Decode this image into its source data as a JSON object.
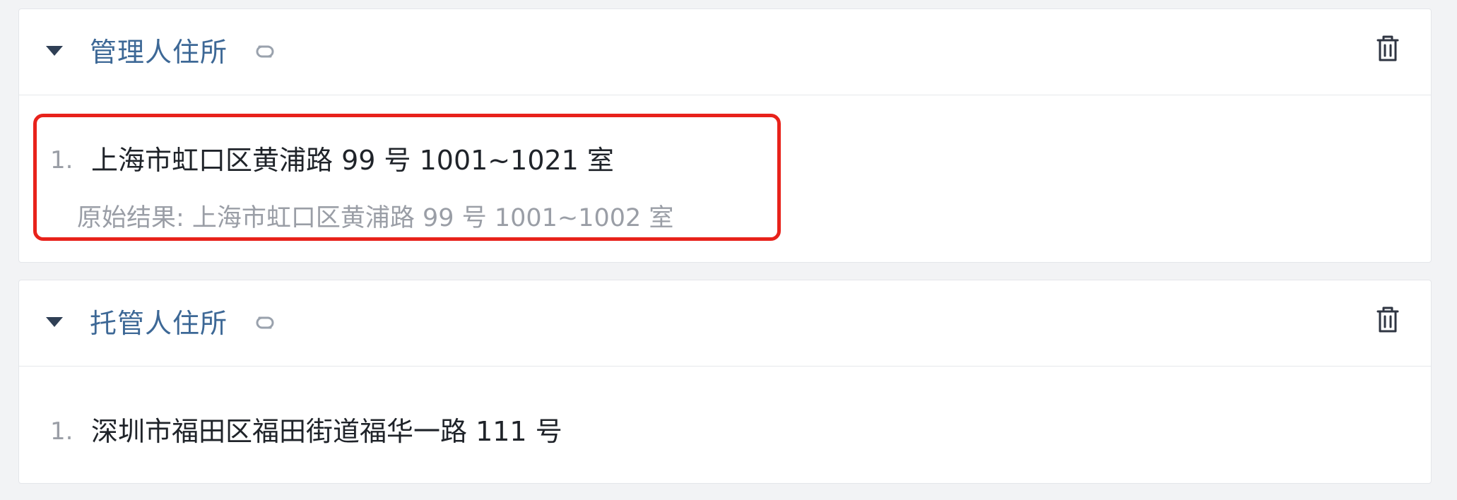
{
  "sections": [
    {
      "title": "管理人住所",
      "items": [
        {
          "index": "1.",
          "value": "上海市虹口区黄浦路 99 号 1001~1021 室",
          "original_label": "原始结果: 上海市虹口区黄浦路 99 号 1001~1002 室"
        }
      ]
    },
    {
      "title": "托管人住所",
      "items": [
        {
          "index": "1.",
          "value": "深圳市福田区福田街道福华一路 111 号"
        }
      ]
    }
  ],
  "colors": {
    "title": "#3d6896",
    "highlight": "#e8221b",
    "text": "#1f2329",
    "muted": "#9a9ea6"
  },
  "icons": {
    "collapse": "caret-down-icon",
    "link": "link-icon",
    "delete": "trash-icon"
  }
}
